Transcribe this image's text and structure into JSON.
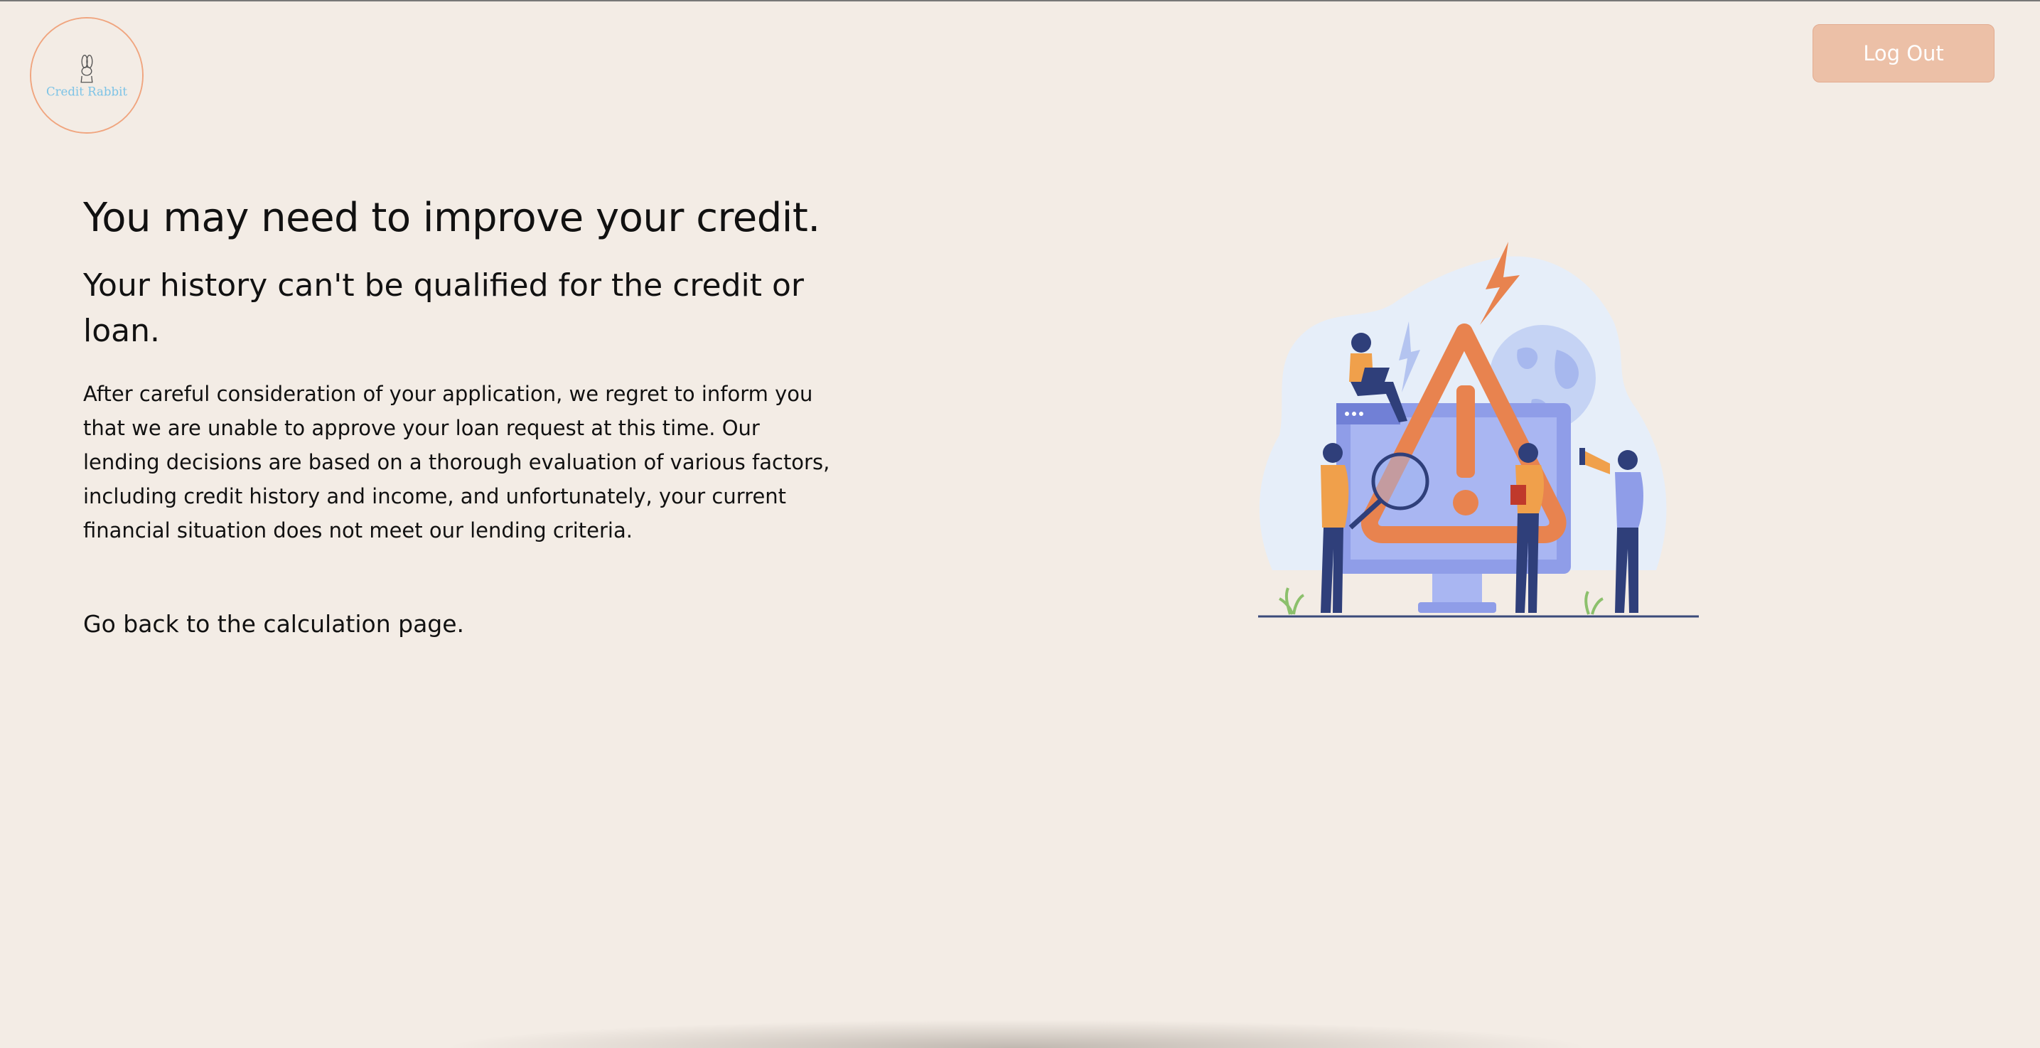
{
  "brand": {
    "logo_text": "Credit Rabbit",
    "accent_color": "#f0a57f",
    "logo_text_color": "#7cc3e6"
  },
  "header": {
    "logout_label": "Log Out",
    "logout_color": "#ecc0a7"
  },
  "main": {
    "title": "You may need to improve your credit.",
    "subtitle": "Your history can't be qualified for the credit or loan.",
    "body": "After careful consideration of your application, we regret to inform you that we are unable to approve your loan request at this time. Our lending decisions are based on a thorough evaluation of various factors, including credit history and income, and unfortunately, your current financial situation does not meet our lending criteria.",
    "back_link": "Go back to the calculation page."
  },
  "illustration": {
    "icons": [
      "warning-triangle-icon",
      "lightning-icon",
      "globe-icon",
      "monitor-icon",
      "magnifier-icon",
      "megaphone-icon",
      "laptop-icon"
    ],
    "colors": {
      "warning": "#e8834f",
      "blob": "#e6eef9",
      "monitor": "#8f9de8",
      "figure_top": "#f0a04b",
      "figure_pants": "#2f3f7a"
    }
  }
}
